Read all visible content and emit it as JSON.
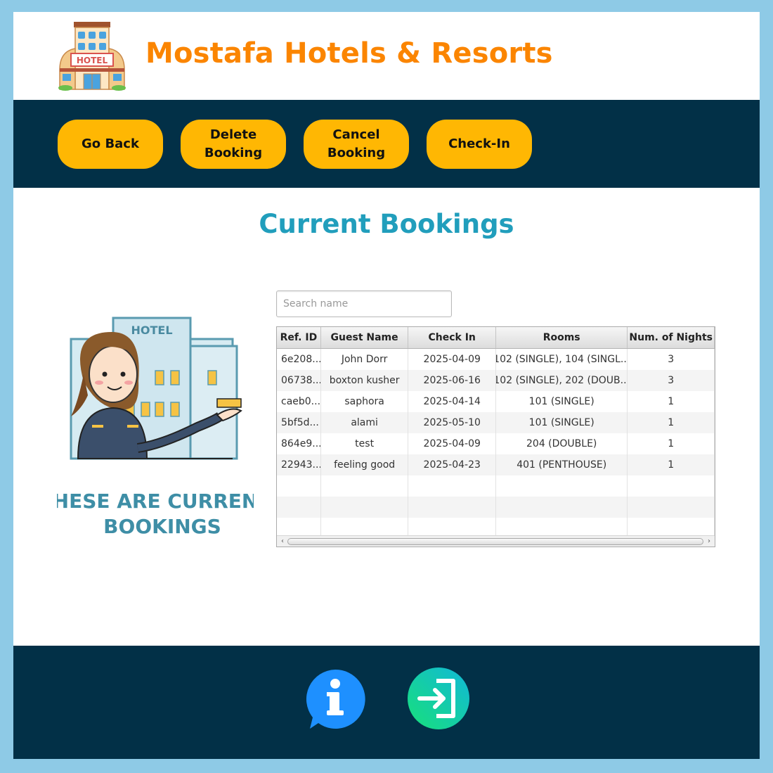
{
  "app": {
    "title": "Mostafa Hotels & Resorts",
    "logo_icon": "hotel-building-icon",
    "accent_color": "#fb8500",
    "navy_color": "#023047",
    "button_color": "#ffb703"
  },
  "toolbar": {
    "buttons": [
      {
        "label": "Go Back"
      },
      {
        "label": "Delete\nBooking"
      },
      {
        "label": "Cancel\nBooking"
      },
      {
        "label": "Check-In"
      }
    ]
  },
  "main": {
    "title": "Current Bookings",
    "illustration_caption_line1": "THESE ARE CURRENT",
    "illustration_caption_line2": "BOOKINGS",
    "illustration_sign": "HOTEL",
    "search": {
      "placeholder": "Search name",
      "value": ""
    },
    "table": {
      "columns": [
        "Ref. ID",
        "Guest Name",
        "Check In",
        "Rooms",
        "Num. of Nights"
      ],
      "rows": [
        [
          "6e208...",
          "John Dorr",
          "2025-04-09",
          "102 (SINGLE), 104 (SINGL...",
          "3"
        ],
        [
          "06738...",
          "boxton kusher",
          "2025-06-16",
          "102 (SINGLE), 202 (DOUB...",
          "3"
        ],
        [
          "caeb0...",
          "saphora",
          "2025-04-14",
          "101 (SINGLE)",
          "1"
        ],
        [
          "5bf5d...",
          "alami",
          "2025-05-10",
          "101 (SINGLE)",
          "1"
        ],
        [
          "864e9...",
          "test",
          "2025-04-09",
          "204 (DOUBLE)",
          "1"
        ],
        [
          "22943...",
          "feeling good",
          "2025-04-23",
          "401 (PENTHOUSE)",
          "1"
        ]
      ]
    }
  },
  "footer": {
    "info_icon": "info-chat-icon",
    "logout_icon": "logout-icon"
  }
}
